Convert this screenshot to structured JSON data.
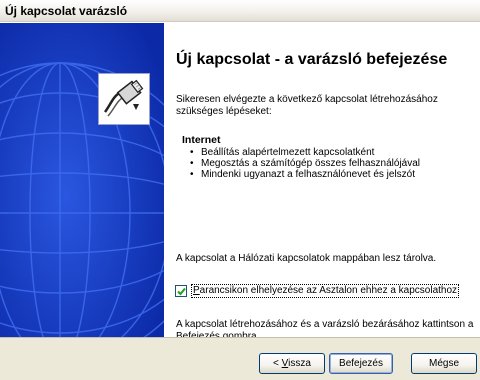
{
  "window": {
    "title": "Új kapcsolat varázsló"
  },
  "wizard": {
    "heading": "Új kapcsolat - a varázsló befejezése",
    "intro": "Sikeresen elvégezte a következő kapcsolat létrehozásához szükséges lépéseket:",
    "summary": {
      "title": "Internet",
      "bullets": [
        "Beállítás alapértelmezett kapcsolatként",
        "Megosztás a számítógép összes felhasználójával",
        "Mindenki ugyanazt a felhasználónevet és jelszót"
      ]
    },
    "save_note": "A kapcsolat a Hálózati kapcsolatok mappában lesz tárolva.",
    "shortcut_checkbox": {
      "label_access_key": "P",
      "label_rest": "arancsikon elhelyezése az Asztalon ehhez a kapcsolathoz",
      "checked": true
    },
    "finish_note": "A kapcsolat létrehozásához és a varázsló bezárásához kattintson a Befejezés gombra."
  },
  "buttons": {
    "back_prefix": "< ",
    "back_access_key": "V",
    "back_rest": "issza",
    "finish": "Befejezés",
    "cancel": "Mégse"
  },
  "colors": {
    "side_panel": "#0f30b8",
    "footer": "#ece9d8",
    "button_border": "#003c74"
  },
  "icons": {
    "wizard_graphic": "network-cable-plug-icon",
    "side_art": "globe-grid-icon",
    "check": "checkmark-icon"
  }
}
